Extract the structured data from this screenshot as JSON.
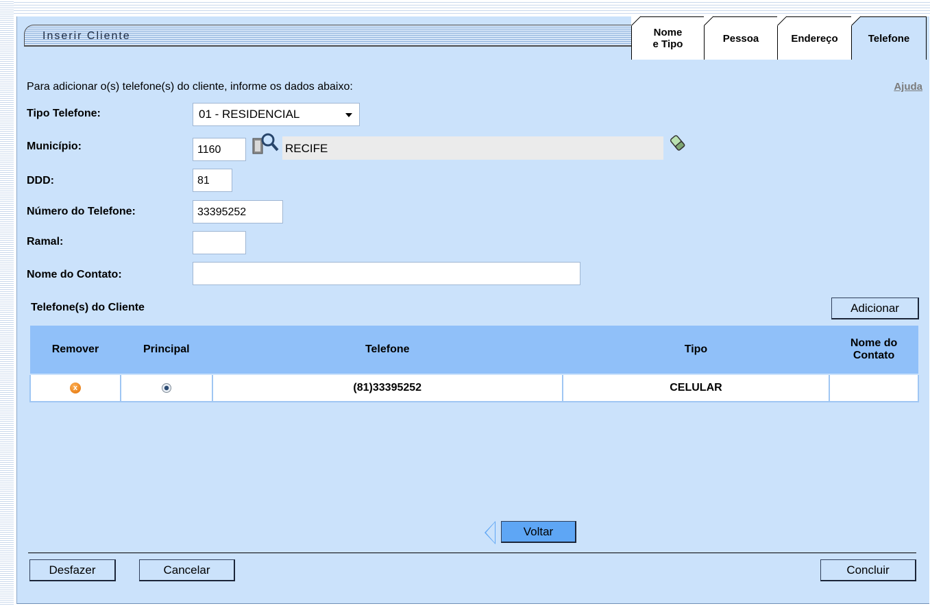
{
  "header": {
    "title": "Inserir Cliente",
    "tabs": [
      {
        "label_line1": "Nome",
        "label_line2": "e Tipo"
      },
      {
        "label": "Pessoa"
      },
      {
        "label": "Endereço"
      },
      {
        "label": "Telefone",
        "active": true
      }
    ]
  },
  "intro_text": "Para adicionar o(s) telefone(s) do cliente, informe os dados abaixo:",
  "help_link": "Ajuda",
  "form": {
    "tipo_telefone": {
      "label": "Tipo Telefone:",
      "value": "01 - RESIDENCIAL"
    },
    "municipio": {
      "label": "Município:",
      "code": "1160",
      "name": "RECIFE"
    },
    "ddd": {
      "label": "DDD:",
      "value": "81"
    },
    "numero": {
      "label": "Número do Telefone:",
      "value": "33395252"
    },
    "ramal": {
      "label": "Ramal:",
      "value": ""
    },
    "contato": {
      "label": "Nome do Contato:",
      "value": ""
    }
  },
  "phones_section": {
    "title": "Telefone(s) do Cliente",
    "add_button": "Adicionar",
    "columns": [
      "Remover",
      "Principal",
      "Telefone",
      "Tipo",
      "Nome do Contato"
    ],
    "rows": [
      {
        "telefone": "(81)33395252",
        "tipo": "CELULAR",
        "contato": ""
      }
    ]
  },
  "buttons": {
    "voltar": "Voltar",
    "desfazer": "Desfazer",
    "cancelar": "Cancelar",
    "concluir": "Concluir"
  },
  "colors": {
    "panel_bg": "#cbe2fb",
    "table_header_bg": "#90c0f9",
    "primary_button": "#5ea6f5"
  }
}
